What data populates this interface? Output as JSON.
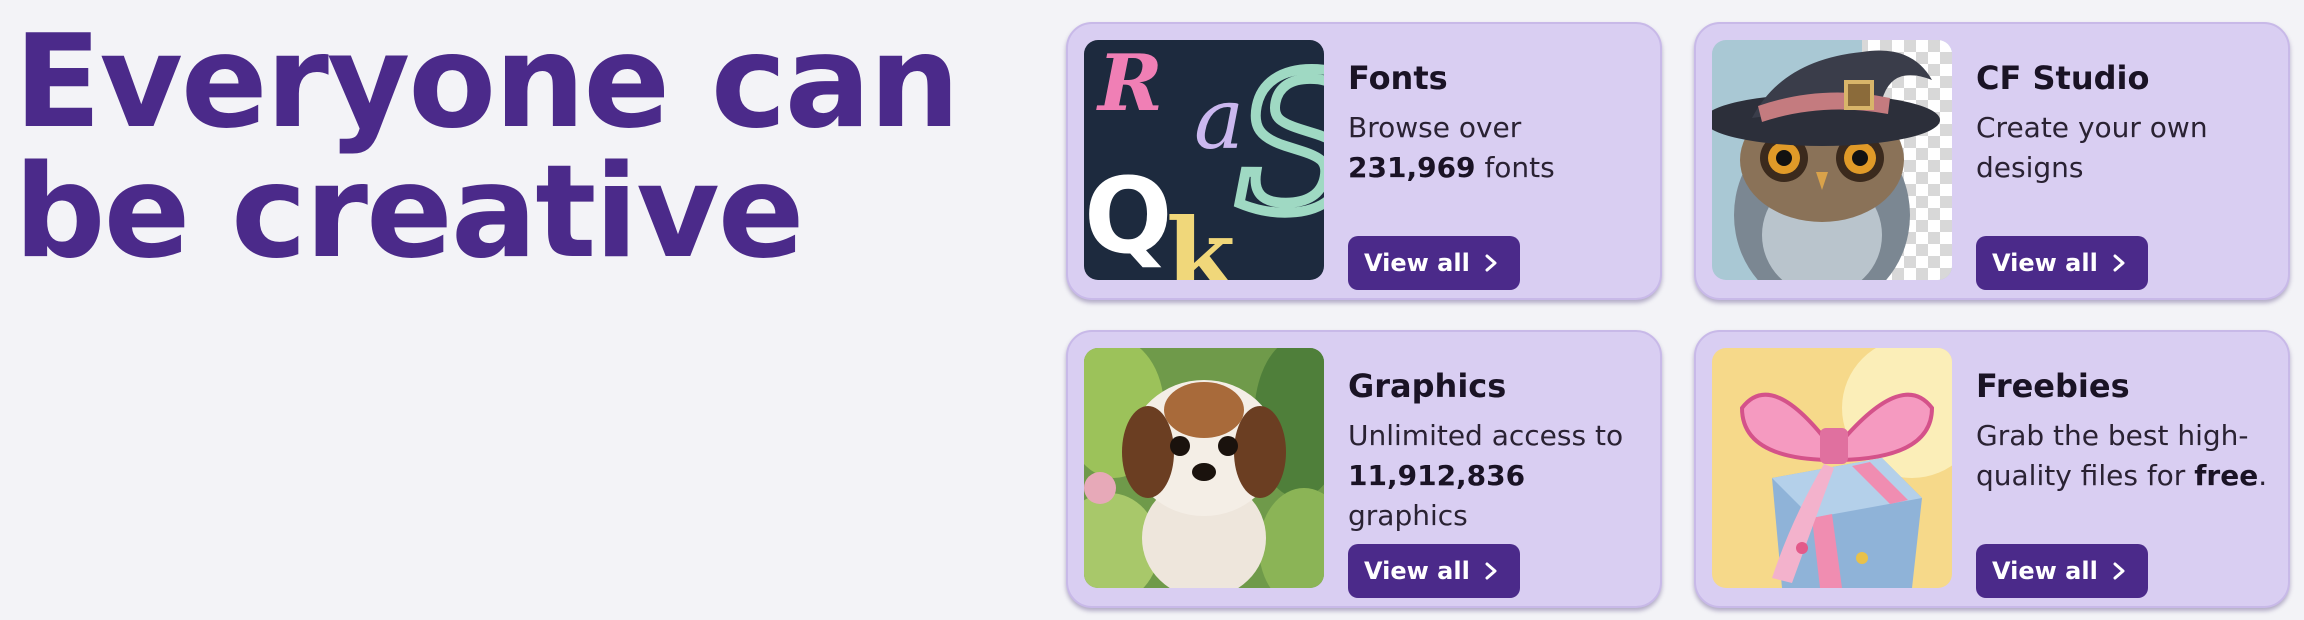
{
  "hero": {
    "line1": "Everyone can",
    "line2": "be creative"
  },
  "colors": {
    "brand_purple": "#4b2a8a",
    "card_bg": "#d9cef2",
    "page_bg": "#f3f3f7"
  },
  "cards": [
    {
      "title": "Fonts",
      "desc_line1": "Browse over",
      "count": "231,969",
      "desc_suffix": "fonts",
      "button": "View all",
      "thumb_letters": [
        "R",
        "a",
        "S",
        "Q",
        "k"
      ]
    },
    {
      "title": "CF Studio",
      "desc": "Create your own designs",
      "button": "View all"
    },
    {
      "title": "Graphics",
      "desc_line1": "Unlimited access to",
      "count": "11,912,836",
      "desc_suffix": "graphics",
      "button": "View all"
    },
    {
      "title": "Freebies",
      "desc_prefix": "Grab the best high-quality files for",
      "desc_bold": "free",
      "desc_end": ".",
      "button": "View all"
    }
  ]
}
